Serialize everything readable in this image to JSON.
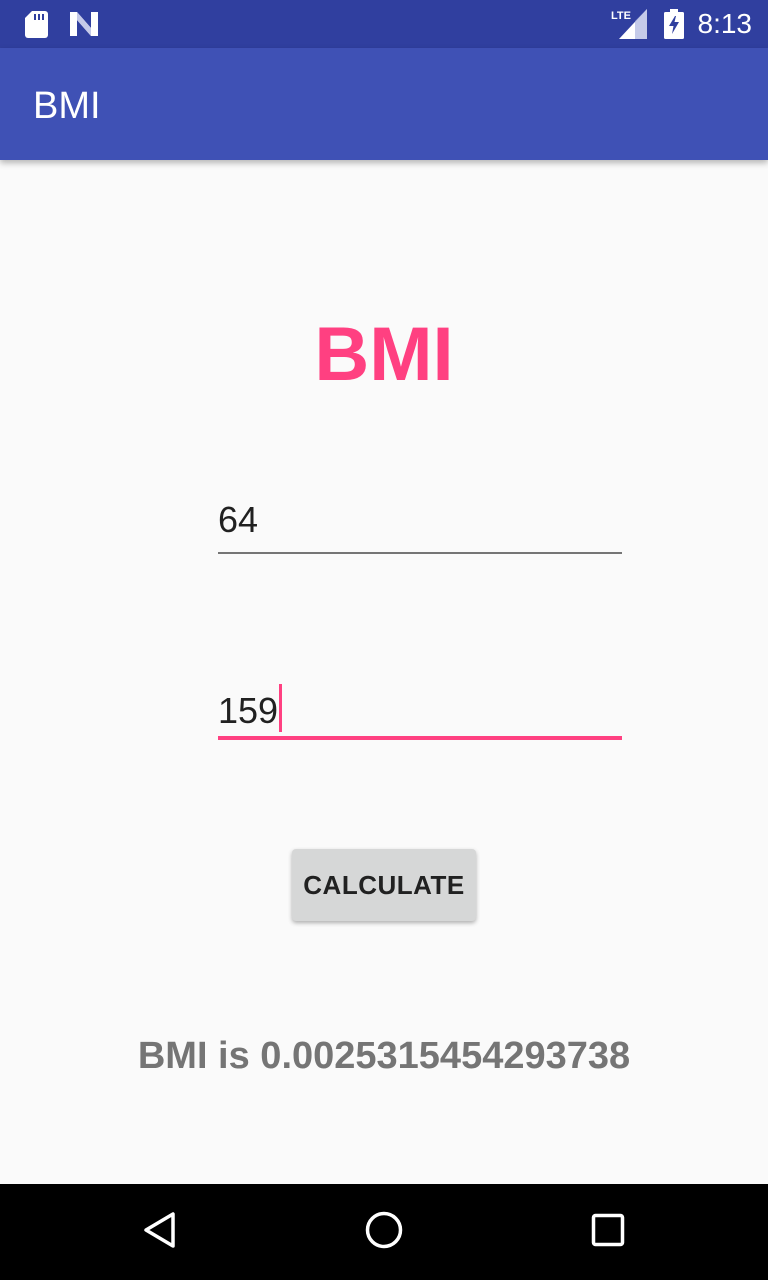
{
  "status_bar": {
    "time": "8:13",
    "network": "LTE",
    "icons": [
      "sd-card-icon",
      "n-notification-icon",
      "lte-signal-icon",
      "battery-charging-icon"
    ]
  },
  "app_bar": {
    "title": "BMI",
    "color": "#3f51b5"
  },
  "main": {
    "heading": "BMI",
    "weight_field": {
      "value": "64",
      "placeholder": ""
    },
    "height_field": {
      "value": "159",
      "placeholder": ""
    },
    "calculate_button": "CALCULATE",
    "result_text": "BMI is 0.0025315454293738"
  },
  "colors": {
    "accent": "#ff4081",
    "status_bar": "#303f9f",
    "primary": "#3f51b5",
    "result_text": "#757575"
  },
  "nav_bar": {
    "icons": [
      "back-icon",
      "home-icon",
      "recents-icon"
    ]
  }
}
